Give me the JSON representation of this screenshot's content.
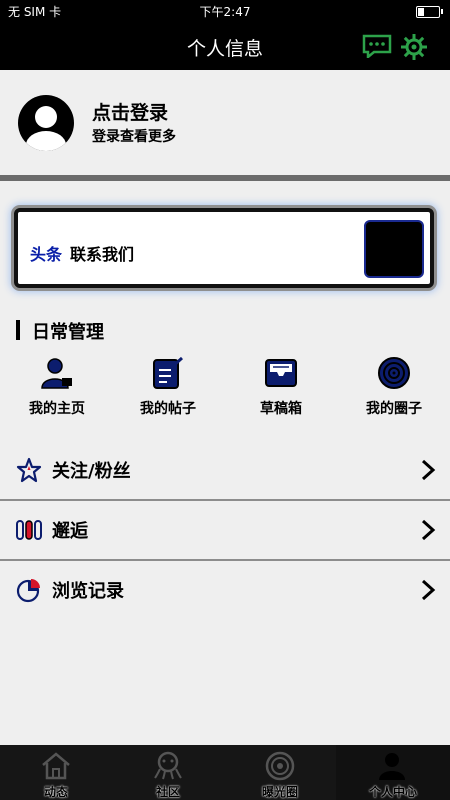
{
  "status_bar": {
    "carrier": "无 SIM 卡",
    "time": "下午2:47"
  },
  "navbar": {
    "title": "个人信息",
    "icons": [
      "chat-icon",
      "gear-icon"
    ]
  },
  "profile": {
    "title": "点击登录",
    "subtitle": "登录查看更多"
  },
  "banner": {
    "brand": "头条",
    "text": "联系我们"
  },
  "daily": {
    "title": "日常管理",
    "items": [
      {
        "label": "我的主页",
        "icon": "user-icon"
      },
      {
        "label": "我的帖子",
        "icon": "edit-icon"
      },
      {
        "label": "草稿箱",
        "icon": "inbox-icon"
      },
      {
        "label": "我的圈子",
        "icon": "circle-icon"
      }
    ]
  },
  "menu": [
    {
      "label": "关注/粉丝",
      "icon": "star-icon"
    },
    {
      "label": "邂逅",
      "icon": "columns-icon"
    },
    {
      "label": "浏览记录",
      "icon": "pie-icon"
    }
  ],
  "tabbar": {
    "tabs": [
      {
        "label": "动态",
        "icon": "home-icon"
      },
      {
        "label": "社区",
        "icon": "octopus-icon"
      },
      {
        "label": "曝光圈",
        "icon": "lens-icon"
      },
      {
        "label": "个人中心",
        "icon": "person-icon"
      }
    ],
    "active": "个人中心"
  },
  "colors": {
    "accent": "#0a1fa8",
    "topbar": "#000000",
    "icon_red": "#d4142a"
  }
}
